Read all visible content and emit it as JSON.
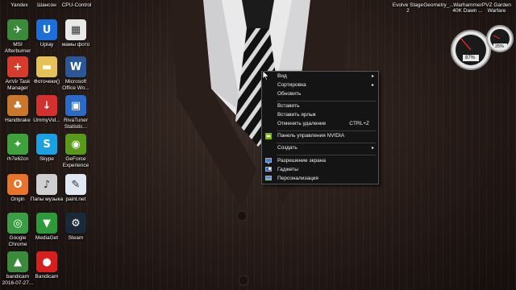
{
  "desktop": {
    "top_row_labels": [
      "Yandex",
      "Шансон",
      "CPU-Control",
      "Evolve Stage 2",
      "Geometry_...",
      "Warhammer 40K Dawn ...",
      "PVZ Garden Warfare"
    ],
    "icons": [
      {
        "label": "MSI Afterburner",
        "icon": "afterburner-icon",
        "color": "#3a8a3a",
        "glyph": "✈"
      },
      {
        "label": "Uplay",
        "icon": "uplay-icon",
        "color": "#1d6fd8",
        "glyph": "U"
      },
      {
        "label": "мамы фото",
        "icon": "photo-folder-icon",
        "color": "#e8e8e8",
        "glyph": "▦"
      },
      {
        "label": "AnVir Task Manager",
        "icon": "anvir-icon",
        "color": "#d73b2b",
        "glyph": "+"
      },
      {
        "label": "Фоточеки()",
        "icon": "folder-icon",
        "color": "#e6c15a",
        "glyph": "▬"
      },
      {
        "label": "Microsoft Office Wo...",
        "icon": "word-icon",
        "color": "#2b5797",
        "glyph": "W"
      },
      {
        "label": "Handbrake",
        "icon": "handbrake-icon",
        "color": "#c9772b",
        "glyph": "♣"
      },
      {
        "label": "UmmyVid...",
        "icon": "ummy-icon",
        "color": "#d3302f",
        "glyph": "↓"
      },
      {
        "label": "RivaTuner Statistic...",
        "icon": "rivatuner-icon",
        "color": "#2a6bc8",
        "glyph": "▣"
      },
      {
        "label": "rh7e62cn",
        "icon": "game-icon",
        "color": "#3ea13c",
        "glyph": "✦"
      },
      {
        "label": "Skype",
        "icon": "skype-icon",
        "color": "#1ba0e1",
        "glyph": "S"
      },
      {
        "label": "GeForce Experience",
        "icon": "geforce-icon",
        "color": "#5a9a1b",
        "glyph": "◉"
      },
      {
        "label": "Origin",
        "icon": "origin-icon",
        "color": "#e8732a",
        "glyph": "O"
      },
      {
        "label": "Папы музыка",
        "icon": "music-folder-icon",
        "color": "#cfcfcf",
        "glyph": "♪"
      },
      {
        "label": "paint.net",
        "icon": "paintnet-icon",
        "color": "#e0e8f4",
        "glyph": "✎"
      },
      {
        "label": "Google Chrome",
        "icon": "chrome-icon",
        "color": "#3b9e45",
        "glyph": "◎"
      },
      {
        "label": "MediaGet",
        "icon": "mediaget-icon",
        "color": "#2c9a3a",
        "glyph": "▼"
      },
      {
        "label": "Steam",
        "icon": "steam-icon",
        "color": "#1b2838",
        "glyph": "⚙"
      },
      {
        "label": "bandicam 2016-07-27...",
        "icon": "bandicam-video-icon",
        "color": "#3c8a3c",
        "glyph": "▲"
      },
      {
        "label": "Bandicam",
        "icon": "bandicam-icon",
        "color": "#d61f1f",
        "glyph": "●"
      }
    ]
  },
  "context_menu": {
    "items": [
      {
        "label": "Вид",
        "submenu": true
      },
      {
        "label": "Сортировка",
        "submenu": true
      },
      {
        "label": "Обновить"
      },
      {
        "label": "Вставить"
      },
      {
        "label": "Вставить ярлык"
      },
      {
        "label": "Отменить удаление",
        "shortcut": "CTRL+Z"
      },
      {
        "label": "Панель управления NVIDIA",
        "icon": "nvidia-icon"
      },
      {
        "label": "Создать",
        "submenu": true
      },
      {
        "label": "Разрешение экрана",
        "icon": "display-icon"
      },
      {
        "label": "Гаджеты",
        "icon": "gadgets-icon"
      },
      {
        "label": "Персонализация",
        "icon": "personalize-icon"
      }
    ],
    "arrow_glyph": "▸"
  },
  "gadgets": {
    "cpu_meter": {
      "cpu_percent": "87%",
      "ram_percent": "25%"
    }
  }
}
